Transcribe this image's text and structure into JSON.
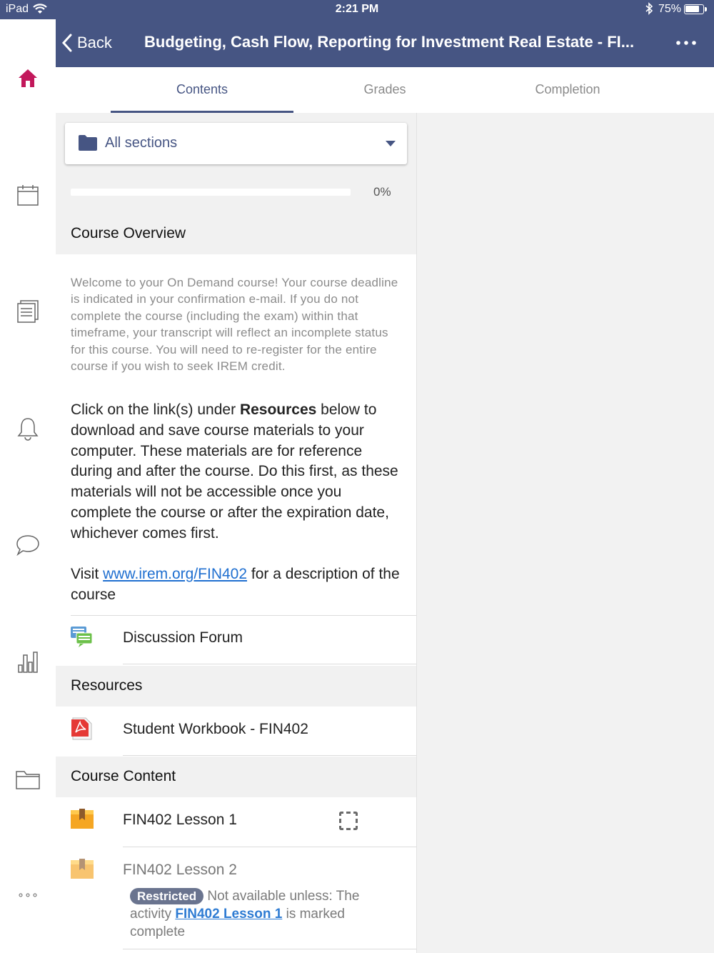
{
  "status_bar": {
    "device": "iPad",
    "time": "2:21 PM",
    "battery": "75%"
  },
  "header": {
    "back_label": "Back",
    "title": "Budgeting, Cash Flow, Reporting for Investment Real Estate - FI..."
  },
  "tabs": [
    {
      "label": "Contents",
      "active": true
    },
    {
      "label": "Grades",
      "active": false
    },
    {
      "label": "Completion",
      "active": false
    }
  ],
  "section_selector": {
    "label": "All sections"
  },
  "progress": {
    "value": 0,
    "label": "0%"
  },
  "course_overview": {
    "title": "Course Overview",
    "notice": "Welcome to your On Demand course! Your course deadline is indicated in your confirmation e-mail. If you do not complete the course (including the exam) within that timeframe, your transcript will reflect an incomplete status for this course. You will need to re-register for the entire course if you wish to seek IREM credit.",
    "instructions_before": "Click on the link(s) under ",
    "instructions_bold": "Resources",
    "instructions_after": " below to download and save course materials to your computer. These materials are for reference during and after the course. Do this first, as these materials will not be accessible once you complete the course or after the expiration date, whichever comes first.",
    "visit_before": "Visit ",
    "visit_link": "www.irem.org/FIN402",
    "visit_after": " for a description of the course"
  },
  "modules": {
    "forum": "Discussion Forum",
    "resources_title": "Resources",
    "workbook": "Student Workbook - FIN402",
    "content_title": "Course Content",
    "lesson1": "FIN402 Lesson 1",
    "lesson2": "FIN402 Lesson 2"
  },
  "restriction": {
    "badge": "Restricted",
    "text_before": " Not available unless: The activity ",
    "link": "FIN402 Lesson 1",
    "text_after": " is marked complete"
  },
  "colors": {
    "brand": "#465583",
    "home_icon": "#c2185b",
    "link": "#1f6fd0"
  }
}
